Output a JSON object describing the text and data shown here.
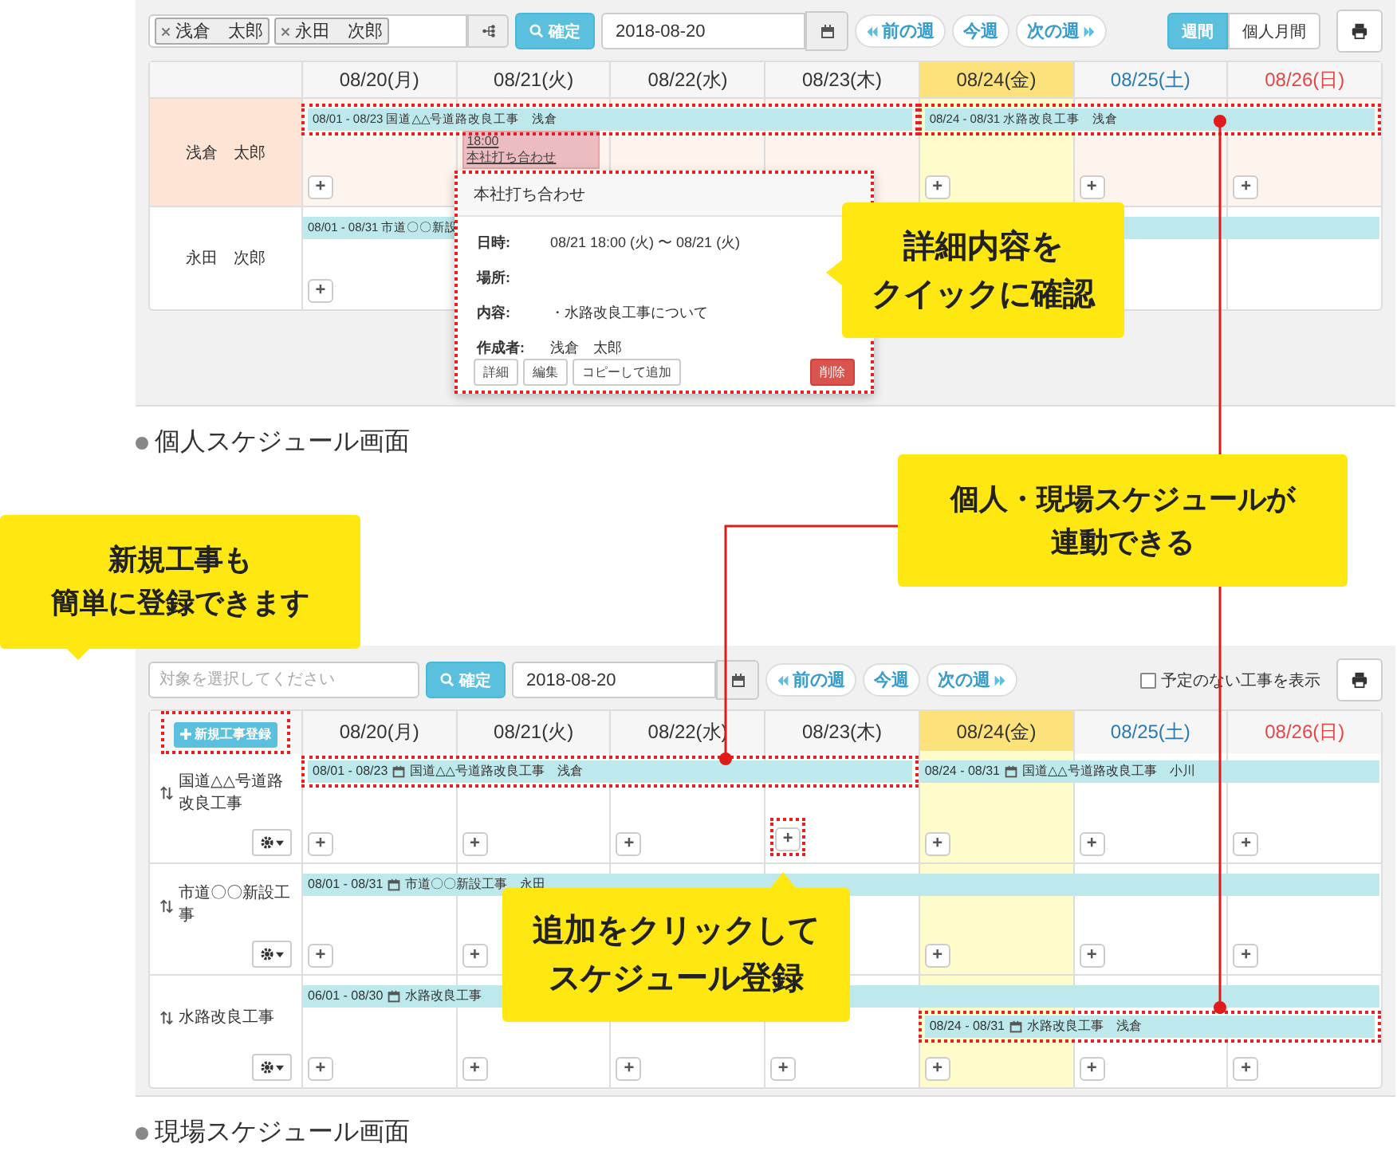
{
  "personal_screen": {
    "toolbar": {
      "people": [
        {
          "name": "浅倉　太郎"
        },
        {
          "name": "永田　次郎"
        }
      ],
      "confirm": "確定",
      "date": "2018-08-20",
      "prev_week": "前の週",
      "this_week": "今週",
      "next_week": "次の週",
      "view_tabs": [
        {
          "label": "週間",
          "selected": true
        },
        {
          "label": "個人月間",
          "selected": false
        }
      ]
    },
    "days": [
      {
        "label": "08/20(月)",
        "kind": "weekday",
        "today": false
      },
      {
        "label": "08/21(火)",
        "kind": "weekday",
        "today": false
      },
      {
        "label": "08/22(水)",
        "kind": "weekday",
        "today": false
      },
      {
        "label": "08/23(木)",
        "kind": "weekday",
        "today": false
      },
      {
        "label": "08/24(金)",
        "kind": "weekday",
        "today": true
      },
      {
        "label": "08/25(土)",
        "kind": "saturday",
        "today": false
      },
      {
        "label": "08/26(日)",
        "kind": "sunday",
        "today": false
      }
    ],
    "rows": [
      {
        "name": "浅倉　太郎",
        "current_user": true,
        "lanes": [
          {
            "bars": [
              {
                "dates": "08/01 - 08/23",
                "title": "国道△△号道路改良工事　浅倉",
                "from_today": false,
                "highlighted": true
              },
              {
                "dates": "08/24 - 08/31",
                "title": "水路改良工事　浅倉",
                "from_today": true,
                "highlighted": true
              }
            ]
          }
        ],
        "cells": [
          {
            "add": "+",
            "highlighted": false
          },
          {
            "events": [
              {
                "time": "18:00",
                "title": "本社打ち合わせ"
              }
            ]
          },
          {},
          {},
          {
            "add": "+",
            "highlighted": false
          },
          {
            "add": "+",
            "highlighted": false
          },
          {
            "add": "+",
            "highlighted": false
          }
        ]
      },
      {
        "name": "永田　次郎",
        "current_user": false,
        "lanes": [
          {
            "bars": [
              {
                "dates": "08/01 - 08/31",
                "title": "市道〇〇新設",
                "from_today": false,
                "highlighted": false
              }
            ]
          }
        ],
        "cells": [
          {
            "add": "+",
            "highlighted": false
          },
          {},
          {},
          {},
          {},
          {},
          {}
        ]
      }
    ],
    "popup": {
      "title": "本社打ち合わせ",
      "highlighted": true,
      "fields": [
        {
          "label": "日時:",
          "value": "08/21 18:00 (火) 〜 08/21 (火)"
        },
        {
          "label": "場所:"
        },
        {
          "label": "内容:",
          "value": "・水路改良工事について"
        },
        {
          "label": "作成者:",
          "value": "浅倉　太郎"
        }
      ],
      "buttons": [
        "詳細",
        "編集",
        "コピーして追加"
      ],
      "delete": "削除"
    },
    "caption": "個人スケジュール画面"
  },
  "site_screen": {
    "toolbar": {
      "placeholder": "対象を選択してください",
      "confirm": "確定",
      "date": "2018-08-20",
      "prev_week": "前の週",
      "this_week": "今週",
      "next_week": "次の週",
      "checkbox": {
        "label": "予定のない工事を表示",
        "checked": false
      }
    },
    "new_project": {
      "label": "新規工事登録",
      "highlighted": true
    },
    "days": [
      {
        "label": "08/20(月)",
        "kind": "weekday",
        "today": false
      },
      {
        "label": "08/21(火)",
        "kind": "weekday",
        "today": false
      },
      {
        "label": "08/22(水)",
        "kind": "weekday",
        "today": false
      },
      {
        "label": "08/23(木)",
        "kind": "weekday",
        "today": false
      },
      {
        "label": "08/24(金)",
        "kind": "weekday",
        "today": true
      },
      {
        "label": "08/25(土)",
        "kind": "saturday",
        "today": false
      },
      {
        "label": "08/26(日)",
        "kind": "sunday",
        "today": false
      }
    ],
    "rows": [
      {
        "name": "国道△△号道路改良工事",
        "lanes": [
          {
            "bars": [
              {
                "dates": "08/01 - 08/23",
                "title": "国道△△号道路改良工事　浅倉",
                "from_today": false,
                "highlighted": true,
                "calendar_icon": true
              },
              {
                "dates": "08/24 - 08/31",
                "title": "国道△△号道路改良工事　小川",
                "from_today": true,
                "highlighted": false,
                "calendar_icon": true
              }
            ]
          }
        ],
        "cells": [
          {
            "add": "+",
            "highlighted": false
          },
          {
            "add": "+",
            "highlighted": false
          },
          {
            "add": "+",
            "highlighted": false
          },
          {
            "add": "+",
            "highlighted": true
          },
          {
            "add": "+",
            "highlighted": false
          },
          {
            "add": "+",
            "highlighted": false
          },
          {
            "add": "+",
            "highlighted": false
          }
        ]
      },
      {
        "name": "市道〇〇新設工事",
        "lanes": [
          {
            "bars": [
              {
                "dates": "08/01 - 08/31",
                "title": "市道〇〇新設工事　永田",
                "from_today": false,
                "highlighted": false,
                "calendar_icon": true
              }
            ]
          }
        ],
        "cells": [
          {
            "add": "+",
            "highlighted": false
          },
          {
            "add": "+",
            "highlighted": false
          },
          {},
          {},
          {
            "add": "+",
            "highlighted": false
          },
          {
            "add": "+",
            "highlighted": false
          },
          {
            "add": "+",
            "highlighted": false
          }
        ]
      },
      {
        "name": "水路改良工事",
        "lanes": [
          {
            "bars": [
              {
                "dates": "06/01 - 08/30",
                "title": "水路改良工事",
                "from_today": false,
                "highlighted": false,
                "calendar_icon": true
              }
            ]
          },
          {
            "bars": [
              {
                "dates": "08/24 - 08/31",
                "title": "水路改良工事　浅倉",
                "from_today": true,
                "highlighted": true,
                "calendar_icon": true
              }
            ]
          }
        ],
        "cells": [
          {
            "add": "+",
            "highlighted": false
          },
          {
            "add": "+",
            "highlighted": false
          },
          {
            "add": "+",
            "highlighted": false
          },
          {
            "add": "+",
            "highlighted": false
          },
          {
            "add": "+",
            "highlighted": false
          },
          {
            "add": "+",
            "highlighted": false
          },
          {
            "add": "+",
            "highlighted": false
          }
        ]
      }
    ],
    "caption": "現場スケジュール画面"
  },
  "callouts": [
    {
      "lines": [
        "詳細内容を",
        "クイックに確認"
      ],
      "kind": "left"
    },
    {
      "lines": [
        "個人・現場スケジュールが",
        "連動できる"
      ],
      "kind": "plain"
    },
    {
      "lines": [
        "新規工事も",
        "簡単に登録できます"
      ],
      "kind": "down"
    },
    {
      "lines": [
        "追加をクリックして",
        "スケジュール登録"
      ],
      "kind": "up"
    }
  ]
}
